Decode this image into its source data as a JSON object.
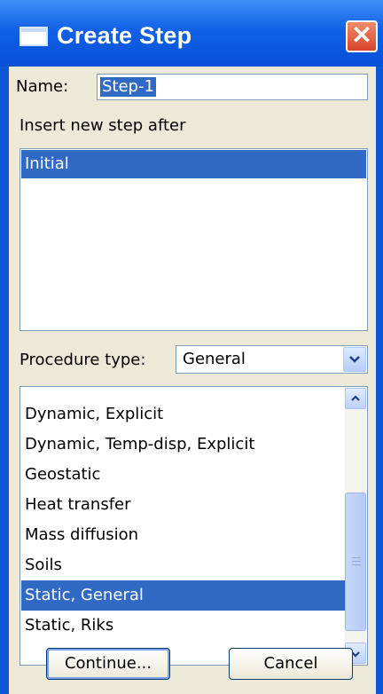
{
  "window": {
    "title": "Create Step",
    "close_glyph": "✕"
  },
  "name": {
    "label": "Name:",
    "value": "Step-1"
  },
  "insert_after": {
    "label": "Insert new step after",
    "items": [
      "Initial"
    ],
    "selected": "Initial"
  },
  "procedure": {
    "label": "Procedure type:",
    "value": "General",
    "items": [
      "Dynamic, Explicit",
      "Dynamic, Temp-disp, Explicit",
      "Geostatic",
      "Heat transfer",
      "Mass diffusion",
      "Soils",
      "Static, General",
      "Static, Riks"
    ],
    "selected": "Static, General"
  },
  "buttons": {
    "continue": "Continue...",
    "cancel": "Cancel"
  },
  "colors": {
    "titlebar": "#0a58d8",
    "selection": "#316ac5",
    "dialog_bg": "#ece9d8",
    "close": "#d8442a"
  }
}
